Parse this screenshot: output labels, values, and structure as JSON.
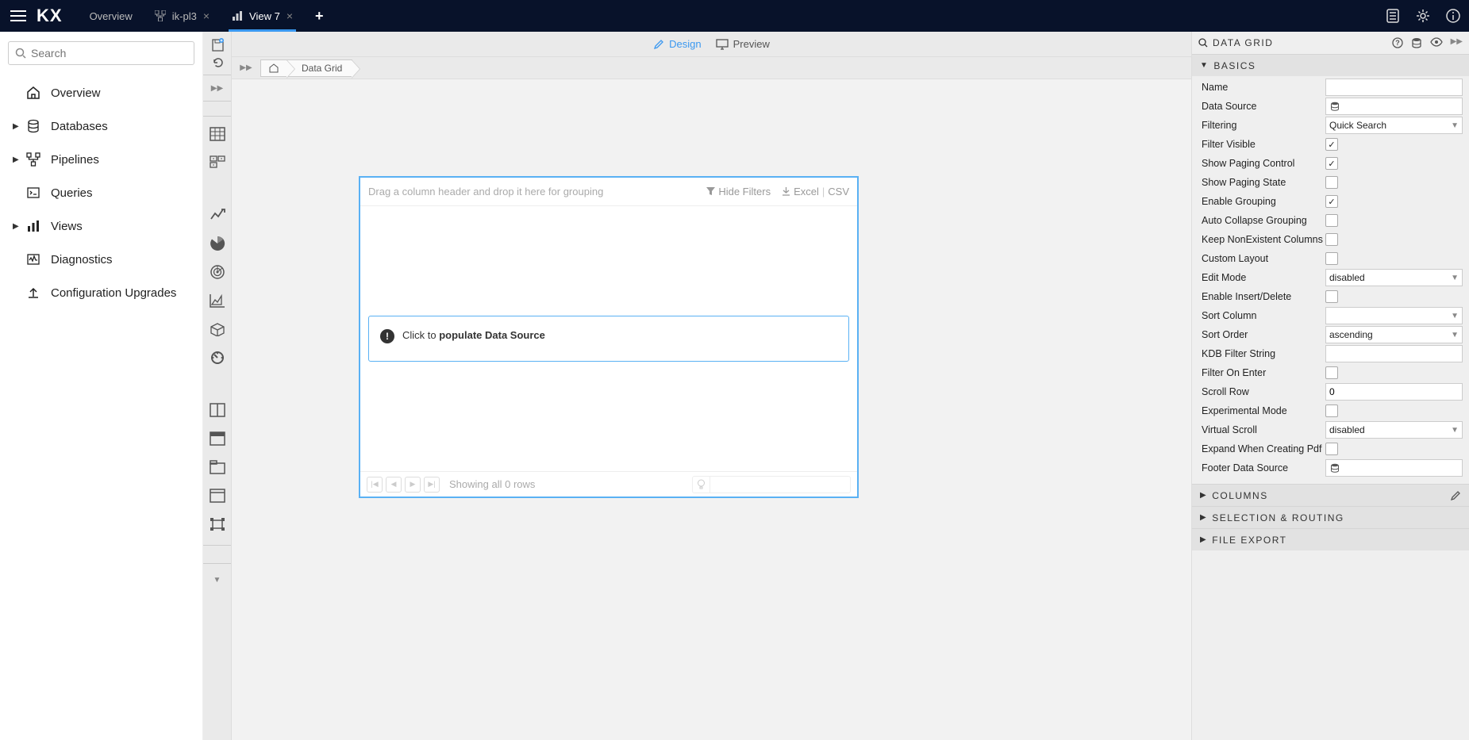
{
  "topbar": {
    "logo": "KX",
    "tabs": [
      {
        "label": "Overview",
        "closable": false,
        "icon": ""
      },
      {
        "label": "ik-pl3",
        "closable": true,
        "icon": "pipeline"
      },
      {
        "label": "View 7",
        "closable": true,
        "icon": "chart",
        "active": true
      }
    ],
    "plus": "+"
  },
  "leftnav": {
    "search_placeholder": "Search",
    "items": [
      {
        "label": "Overview",
        "icon": "home",
        "expandable": false
      },
      {
        "label": "Databases",
        "icon": "database",
        "expandable": true
      },
      {
        "label": "Pipelines",
        "icon": "pipeline",
        "expandable": true
      },
      {
        "label": "Queries",
        "icon": "query",
        "expandable": false
      },
      {
        "label": "Views",
        "icon": "views",
        "expandable": true
      },
      {
        "label": "Diagnostics",
        "icon": "diagnostics",
        "expandable": false
      },
      {
        "label": "Configuration Upgrades",
        "icon": "upload",
        "expandable": false
      }
    ]
  },
  "toolbar": {
    "design": "Design",
    "preview": "Preview"
  },
  "breadcrumb": {
    "item": "Data Grid"
  },
  "datagrid": {
    "drop_hint": "Drag a column header and drop it here for grouping",
    "hide_filters": "Hide Filters",
    "excel": "Excel",
    "csv": "CSV",
    "populate_prefix": "Click to ",
    "populate_strong": "populate Data Source",
    "footer_status": "Showing all 0 rows"
  },
  "rightpanel": {
    "title": "DATA GRID",
    "sections": {
      "basics": "BASICS",
      "columns": "COLUMNS",
      "selection": "SELECTION & ROUTING",
      "file_export": "FILE EXPORT"
    },
    "props": {
      "name": {
        "label": "Name",
        "value": ""
      },
      "data_source": {
        "label": "Data Source"
      },
      "filtering": {
        "label": "Filtering",
        "value": "Quick Search"
      },
      "filter_visible": {
        "label": "Filter Visible",
        "checked": true
      },
      "show_paging_control": {
        "label": "Show Paging Control",
        "checked": true
      },
      "show_paging_state": {
        "label": "Show Paging State",
        "checked": false
      },
      "enable_grouping": {
        "label": "Enable Grouping",
        "checked": true
      },
      "auto_collapse_grouping": {
        "label": "Auto Collapse Grouping",
        "checked": false
      },
      "keep_nonexistent": {
        "label": "Keep NonExistent Columns",
        "checked": false
      },
      "custom_layout": {
        "label": "Custom Layout",
        "checked": false
      },
      "edit_mode": {
        "label": "Edit Mode",
        "value": "disabled"
      },
      "enable_insert_delete": {
        "label": "Enable Insert/Delete",
        "checked": false
      },
      "sort_column": {
        "label": "Sort Column",
        "value": ""
      },
      "sort_order": {
        "label": "Sort Order",
        "value": "ascending"
      },
      "kdb_filter_string": {
        "label": "KDB Filter String",
        "value": ""
      },
      "filter_on_enter": {
        "label": "Filter On Enter",
        "checked": false
      },
      "scroll_row": {
        "label": "Scroll Row",
        "value": "0"
      },
      "experimental_mode": {
        "label": "Experimental Mode",
        "checked": false
      },
      "virtual_scroll": {
        "label": "Virtual Scroll",
        "value": "disabled"
      },
      "expand_pdf": {
        "label": "Expand When Creating Pdf",
        "checked": false
      },
      "footer_data_source": {
        "label": "Footer Data Source"
      }
    }
  }
}
